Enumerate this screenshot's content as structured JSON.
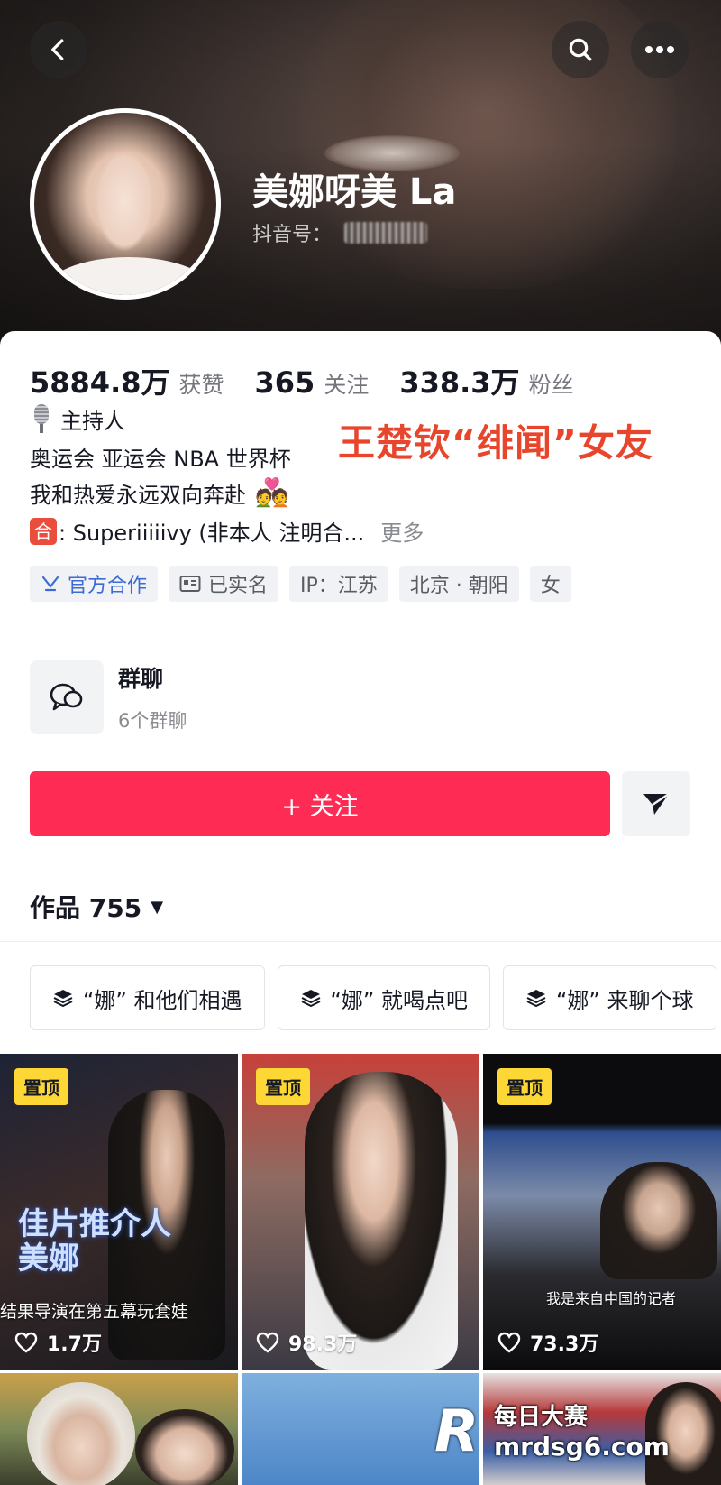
{
  "header": {
    "name": "美娜呀美 La",
    "douyin_id_label": "抖音号："
  },
  "stats": [
    {
      "value": "5884.8万",
      "label": "获赞"
    },
    {
      "value": "365",
      "label": "关注"
    },
    {
      "value": "338.3万",
      "label": "粉丝"
    }
  ],
  "headline": "王楚钦“绯闻”女友",
  "bio": {
    "line1": "主持人",
    "line2": "奥运会 亚运会 NBA 世界杯",
    "line3": "我和热爱永远双向奔赴",
    "line3_emoji": "💑",
    "line4_badge": "合",
    "line4": ": Superiiiiivy (非本人 注明合...",
    "more": "更多"
  },
  "tags": [
    {
      "icon": "official-icon",
      "label": "官方合作"
    },
    {
      "icon": "id-card-icon",
      "label": "已实名"
    },
    {
      "label": "IP：江苏"
    },
    {
      "label": "北京 · 朝阳"
    },
    {
      "label": "女"
    }
  ],
  "group_chat": {
    "title": "群聊",
    "subtitle": "6个群聊"
  },
  "actions": {
    "follow_label": "+ 关注"
  },
  "works": {
    "label": "作品 755"
  },
  "collections": [
    "“娜” 和他们相遇",
    "“娜” 就喝点吧",
    "“娜” 来聊个球"
  ],
  "videos": [
    {
      "pinned": "置顶",
      "likes": "1.7万",
      "overlay": "佳片推介人\n美娜",
      "caption": "结果导演在第五幕玩套娃"
    },
    {
      "pinned": "置顶",
      "likes": "98.3万"
    },
    {
      "pinned": "置顶",
      "likes": "73.3万",
      "caption": "我是来自中国的记者"
    }
  ],
  "watermark": {
    "logo": "R",
    "line1": "每日大赛",
    "line2": "mrdsg6.com"
  },
  "colors": {
    "follow": "#fe2c55",
    "headline": "#e8452d",
    "pin": "#fcd735"
  }
}
